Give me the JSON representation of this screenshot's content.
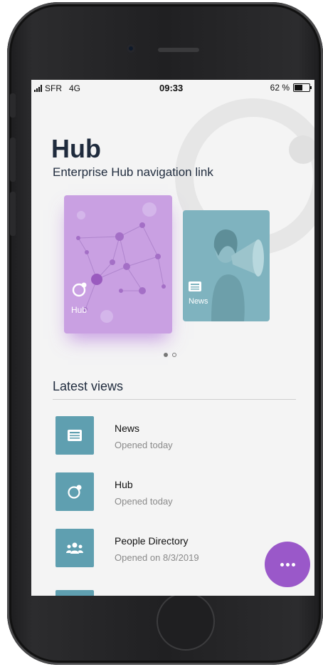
{
  "status_bar": {
    "carrier": "SFR",
    "network": "4G",
    "time": "09:33",
    "battery": "62 %",
    "battery_level": 0.62
  },
  "header": {
    "title": "Hub",
    "subtitle": "Enterprise Hub navigation link"
  },
  "carousel": {
    "cards": [
      {
        "label": "Hub",
        "icon": "hub-ring-icon",
        "color": "#c9a0e2"
      },
      {
        "label": "News",
        "icon": "newspaper-icon",
        "color": "#7fb3bf"
      }
    ],
    "pages": 2,
    "active_page": 1
  },
  "latest_views": {
    "title": "Latest views",
    "items": [
      {
        "name": "News",
        "subtitle": "Opened today",
        "icon": "newspaper-icon"
      },
      {
        "name": "Hub",
        "subtitle": "Opened today",
        "icon": "hub-ring-icon"
      },
      {
        "name": "People Directory",
        "subtitle": "Opened on 8/3/2019",
        "icon": "people-icon"
      }
    ]
  },
  "fab": {
    "icon": "more-icon",
    "color": "#9a58c9"
  },
  "colors": {
    "accent": "#9a58c9",
    "tile": "#5f9fb0",
    "title": "#1f2b3d"
  }
}
